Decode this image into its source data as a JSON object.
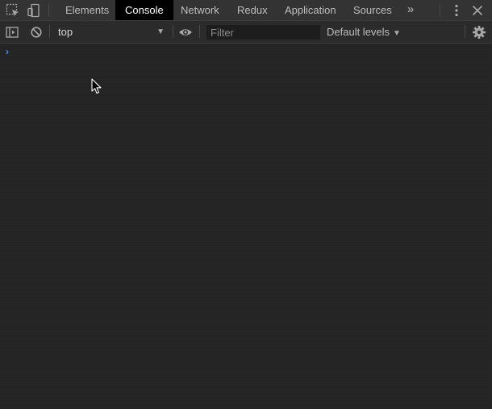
{
  "tabbar": {
    "tabs": [
      {
        "label": "Elements",
        "active": false
      },
      {
        "label": "Console",
        "active": true
      },
      {
        "label": "Network",
        "active": false
      },
      {
        "label": "Redux",
        "active": false
      },
      {
        "label": "Application",
        "active": false
      },
      {
        "label": "Sources",
        "active": false
      }
    ],
    "more_tabs_glyph": "»",
    "icons": {
      "inspect": "inspect-element-icon",
      "device": "device-toolbar-icon",
      "menu": "kebab-menu-icon",
      "close": "close-icon"
    }
  },
  "toolbar": {
    "context_value": "top",
    "filter_placeholder": "Filter",
    "filter_value": "",
    "levels_label": "Default levels",
    "icons": {
      "sidebar": "show-sidebar-icon",
      "clear": "clear-console-icon",
      "live_expression": "eye-icon",
      "settings": "gear-icon",
      "dropdown": "chevron-down-icon"
    }
  },
  "console": {
    "prompt_glyph": "›"
  },
  "colors": {
    "background": "#242424",
    "tabbar": "#333333",
    "toolbar": "#2b2b2b",
    "active_tab": "#000000",
    "prompt": "#4c8ff5"
  }
}
